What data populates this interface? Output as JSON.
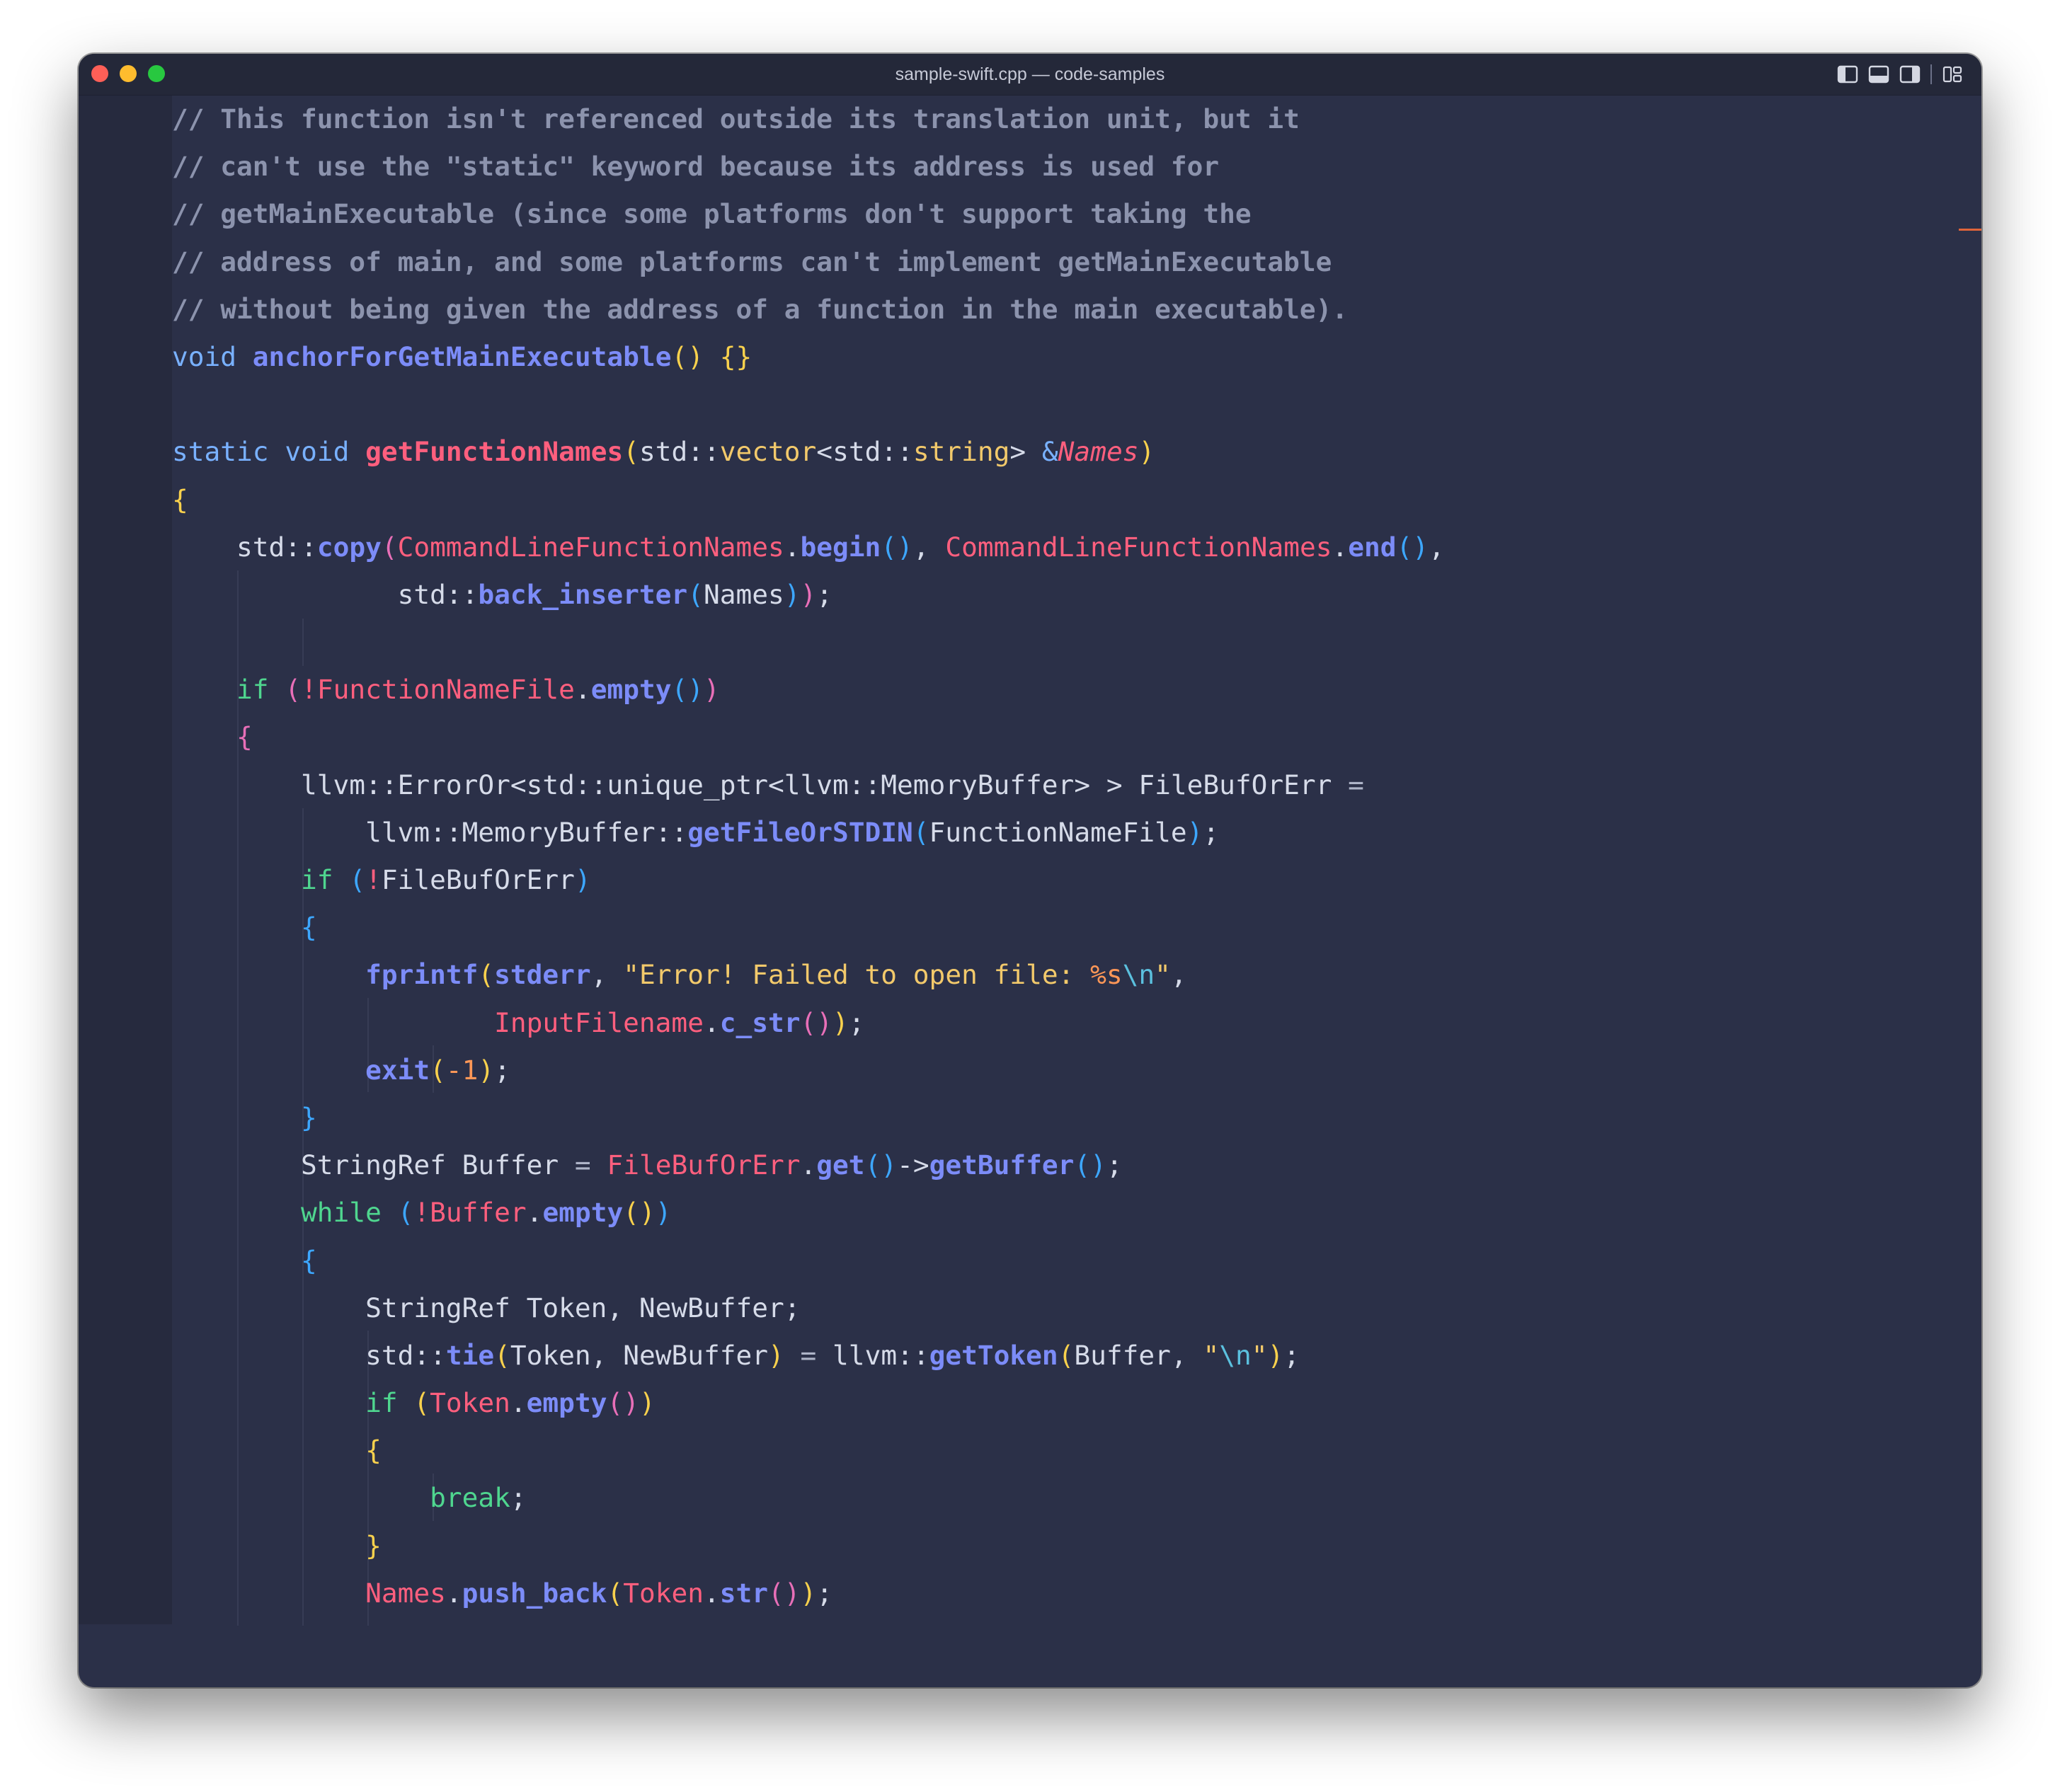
{
  "window": {
    "title": "sample-swift.cpp — code-samples",
    "layout_icons": [
      "sidebar-left-icon",
      "panel-bottom-icon",
      "sidebar-right-icon",
      "customize-layout-icon"
    ]
  },
  "editor": {
    "language": "cpp",
    "lines": [
      [
        {
          "t": "// This function isn't referenced outside its translation unit, but it",
          "c": "cm"
        }
      ],
      [
        {
          "t": "// can't use the \"static\" keyword because its address is used for",
          "c": "cm"
        }
      ],
      [
        {
          "t": "// getMainExecutable (since some platforms don't support taking the",
          "c": "cm"
        }
      ],
      [
        {
          "t": "// address of main, and some platforms can't implement getMainExecutable",
          "c": "cm"
        }
      ],
      [
        {
          "t": "// without being given the address of a function in the main executable).",
          "c": "cm"
        }
      ],
      [
        {
          "t": "void",
          "c": "kw"
        },
        {
          "t": " "
        },
        {
          "t": "anchorForGetMainExecutable",
          "c": "fn"
        },
        {
          "t": "()",
          "c": "b-y"
        },
        {
          "t": " "
        },
        {
          "t": "{}",
          "c": "b-y"
        }
      ],
      [],
      [
        {
          "t": "static",
          "c": "kw"
        },
        {
          "t": " "
        },
        {
          "t": "void",
          "c": "kw"
        },
        {
          "t": " "
        },
        {
          "t": "getFunctionNames",
          "c": "fd"
        },
        {
          "t": "(",
          "c": "b-y"
        },
        {
          "t": "std::"
        },
        {
          "t": "vector",
          "c": "ty"
        },
        {
          "t": "<"
        },
        {
          "t": "std::"
        },
        {
          "t": "string",
          "c": "ty"
        },
        {
          "t": "> "
        },
        {
          "t": "&",
          "c": "kw"
        },
        {
          "t": "Names",
          "c": "pm"
        },
        {
          "t": ")",
          "c": "b-y"
        }
      ],
      [
        {
          "t": "{",
          "c": "b-y"
        }
      ],
      [
        {
          "t": "    std::"
        },
        {
          "t": "copy",
          "c": "fn"
        },
        {
          "t": "(",
          "c": "b-p"
        },
        {
          "t": "CommandLineFunctionNames",
          "c": "id"
        },
        {
          "t": "."
        },
        {
          "t": "begin",
          "c": "fn"
        },
        {
          "t": "()",
          "c": "b-b"
        },
        {
          "t": ", "
        },
        {
          "t": "CommandLineFunctionNames",
          "c": "id"
        },
        {
          "t": "."
        },
        {
          "t": "end",
          "c": "fn"
        },
        {
          "t": "()",
          "c": "b-b"
        },
        {
          "t": ","
        }
      ],
      [
        {
          "t": "              std::"
        },
        {
          "t": "back_inserter",
          "c": "fn"
        },
        {
          "t": "(",
          "c": "b-b"
        },
        {
          "t": "Names"
        },
        {
          "t": ")",
          "c": "b-b"
        },
        {
          "t": ")",
          "c": "b-p"
        },
        {
          "t": ";"
        }
      ],
      [],
      [
        {
          "t": "    "
        },
        {
          "t": "if",
          "c": "ctl"
        },
        {
          "t": " "
        },
        {
          "t": "(",
          "c": "b-p"
        },
        {
          "t": "!",
          "c": "id"
        },
        {
          "t": "FunctionNameFile",
          "c": "id"
        },
        {
          "t": "."
        },
        {
          "t": "empty",
          "c": "fn"
        },
        {
          "t": "()",
          "c": "b-b"
        },
        {
          "t": ")",
          "c": "b-p"
        }
      ],
      [
        {
          "t": "    "
        },
        {
          "t": "{",
          "c": "b-p"
        }
      ],
      [
        {
          "t": "        llvm::ErrorOr<std::unique_ptr<llvm::MemoryBuffer> > FileBufOrErr "
        },
        {
          "t": "=",
          "c": "op"
        }
      ],
      [
        {
          "t": "            llvm::MemoryBuffer::"
        },
        {
          "t": "getFileOrSTDIN",
          "c": "fn"
        },
        {
          "t": "(",
          "c": "b-b"
        },
        {
          "t": "FunctionNameFile"
        },
        {
          "t": ")",
          "c": "b-b"
        },
        {
          "t": ";"
        }
      ],
      [
        {
          "t": "        "
        },
        {
          "t": "if",
          "c": "ctl"
        },
        {
          "t": " "
        },
        {
          "t": "(",
          "c": "b-b"
        },
        {
          "t": "!",
          "c": "id"
        },
        {
          "t": "FileBufOrErr"
        },
        {
          "t": ")",
          "c": "b-b"
        }
      ],
      [
        {
          "t": "        "
        },
        {
          "t": "{",
          "c": "b-b"
        }
      ],
      [
        {
          "t": "            "
        },
        {
          "t": "fprintf",
          "c": "fn"
        },
        {
          "t": "(",
          "c": "b-y"
        },
        {
          "t": "stderr",
          "c": "fn"
        },
        {
          "t": ", "
        },
        {
          "t": "\"Error! Failed to open file: ",
          "c": "str"
        },
        {
          "t": "%s",
          "c": "fmt"
        },
        {
          "t": "\\n",
          "c": "esc"
        },
        {
          "t": "\"",
          "c": "str"
        },
        {
          "t": ","
        }
      ],
      [
        {
          "t": "                    "
        },
        {
          "t": "InputFilename",
          "c": "id"
        },
        {
          "t": "."
        },
        {
          "t": "c_str",
          "c": "fn"
        },
        {
          "t": "()",
          "c": "b-p"
        },
        {
          "t": ")",
          "c": "b-y"
        },
        {
          "t": ";"
        }
      ],
      [
        {
          "t": "            "
        },
        {
          "t": "exit",
          "c": "fn"
        },
        {
          "t": "(",
          "c": "b-y"
        },
        {
          "t": "-1",
          "c": "num"
        },
        {
          "t": ")",
          "c": "b-y"
        },
        {
          "t": ";"
        }
      ],
      [
        {
          "t": "        "
        },
        {
          "t": "}",
          "c": "b-b"
        }
      ],
      [
        {
          "t": "        StringRef Buffer "
        },
        {
          "t": "=",
          "c": "op"
        },
        {
          "t": " "
        },
        {
          "t": "FileBufOrErr",
          "c": "id"
        },
        {
          "t": "."
        },
        {
          "t": "get",
          "c": "fn"
        },
        {
          "t": "()",
          "c": "b-b"
        },
        {
          "t": "->"
        },
        {
          "t": "getBuffer",
          "c": "fn"
        },
        {
          "t": "()",
          "c": "b-b"
        },
        {
          "t": ";"
        }
      ],
      [
        {
          "t": "        "
        },
        {
          "t": "while",
          "c": "ctl"
        },
        {
          "t": " "
        },
        {
          "t": "(",
          "c": "b-b"
        },
        {
          "t": "!",
          "c": "id"
        },
        {
          "t": "Buffer",
          "c": "id"
        },
        {
          "t": "."
        },
        {
          "t": "empty",
          "c": "fn"
        },
        {
          "t": "()",
          "c": "b-y"
        },
        {
          "t": ")",
          "c": "b-b"
        }
      ],
      [
        {
          "t": "        "
        },
        {
          "t": "{",
          "c": "b-b"
        }
      ],
      [
        {
          "t": "            StringRef Token, NewBuffer;"
        }
      ],
      [
        {
          "t": "            std::"
        },
        {
          "t": "tie",
          "c": "fn"
        },
        {
          "t": "(",
          "c": "b-y"
        },
        {
          "t": "Token, NewBuffer"
        },
        {
          "t": ")",
          "c": "b-y"
        },
        {
          "t": " "
        },
        {
          "t": "=",
          "c": "op"
        },
        {
          "t": " llvm::"
        },
        {
          "t": "getToken",
          "c": "fn"
        },
        {
          "t": "(",
          "c": "b-y"
        },
        {
          "t": "Buffer, "
        },
        {
          "t": "\"",
          "c": "str"
        },
        {
          "t": "\\n",
          "c": "esc"
        },
        {
          "t": "\"",
          "c": "str"
        },
        {
          "t": ")",
          "c": "b-y"
        },
        {
          "t": ";"
        }
      ],
      [
        {
          "t": "            "
        },
        {
          "t": "if",
          "c": "ctl"
        },
        {
          "t": " "
        },
        {
          "t": "(",
          "c": "b-y"
        },
        {
          "t": "Token",
          "c": "id"
        },
        {
          "t": "."
        },
        {
          "t": "empty",
          "c": "fn"
        },
        {
          "t": "()",
          "c": "b-p"
        },
        {
          "t": ")",
          "c": "b-y"
        }
      ],
      [
        {
          "t": "            "
        },
        {
          "t": "{",
          "c": "b-y"
        }
      ],
      [
        {
          "t": "                "
        },
        {
          "t": "break",
          "c": "ctl"
        },
        {
          "t": ";"
        }
      ],
      [
        {
          "t": "            "
        },
        {
          "t": "}",
          "c": "b-y"
        }
      ],
      [
        {
          "t": "            "
        },
        {
          "t": "Names",
          "c": "id"
        },
        {
          "t": "."
        },
        {
          "t": "push_back",
          "c": "fn"
        },
        {
          "t": "(",
          "c": "b-y"
        },
        {
          "t": "Token",
          "c": "id"
        },
        {
          "t": "."
        },
        {
          "t": "str",
          "c": "fn"
        },
        {
          "t": "()",
          "c": "b-p"
        },
        {
          "t": ")",
          "c": "b-y"
        },
        {
          "t": ";"
        }
      ]
    ]
  },
  "colors": {
    "background": "#2b3048",
    "titlebar": "#242839",
    "comment": "#8c93ad",
    "keyword": "#79b1ff",
    "control": "#4fd68f",
    "function": "#7c8cf8",
    "declaration": "#ff5f7e",
    "type": "#f2c96b",
    "identifier": "#ff5f7e",
    "string": "#f2c96b",
    "escape": "#5bc0de",
    "number": "#ff9757",
    "scroll_marker": "#e0643a"
  }
}
